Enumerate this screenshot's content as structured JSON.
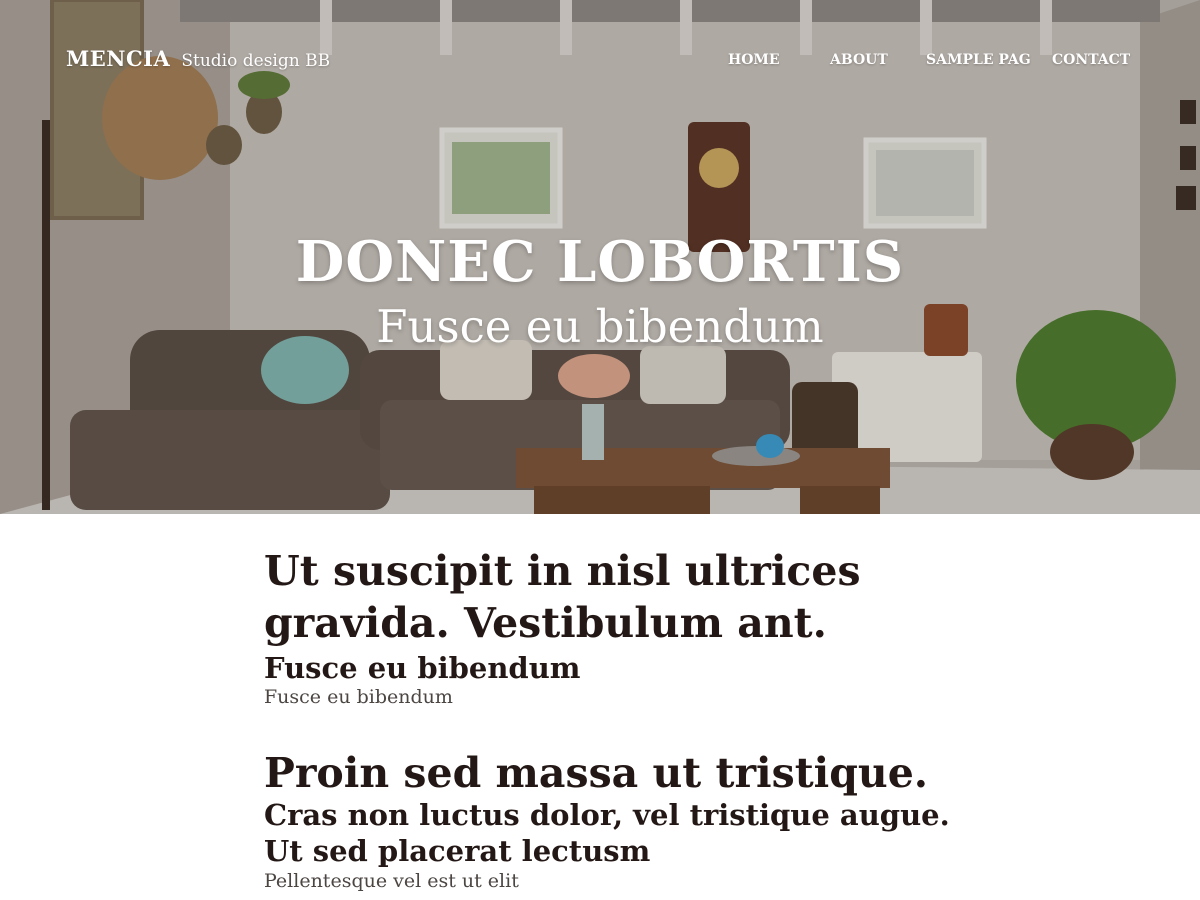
{
  "brand": {
    "name": "MENCIA",
    "tagline": "Studio design BB"
  },
  "nav": {
    "home": "HOME",
    "about": "ABOUT",
    "sample": "SAMPLE PAG",
    "contact": "CONTACT"
  },
  "hero": {
    "title": "DONEC LOBORTIS",
    "subtitle": "Fusce eu bibendum",
    "image_icon": "living-room-photo"
  },
  "section1": {
    "heading": "Ut suscipit in nisl ultrices gravida. Vestibulum ant.",
    "subheading": "Fusce eu bibendum",
    "caption": "Fusce eu bibendum"
  },
  "section2": {
    "heading": "Proin sed massa ut tristique.",
    "line1": "Cras non luctus dolor, vel tristique augue.",
    "line2": "Ut sed placerat lectusm",
    "caption": "Pellentesque vel est ut elit"
  },
  "colors": {
    "text_dark": "#231815",
    "text_muted": "#4c4643",
    "hero_text": "#ffffff"
  }
}
